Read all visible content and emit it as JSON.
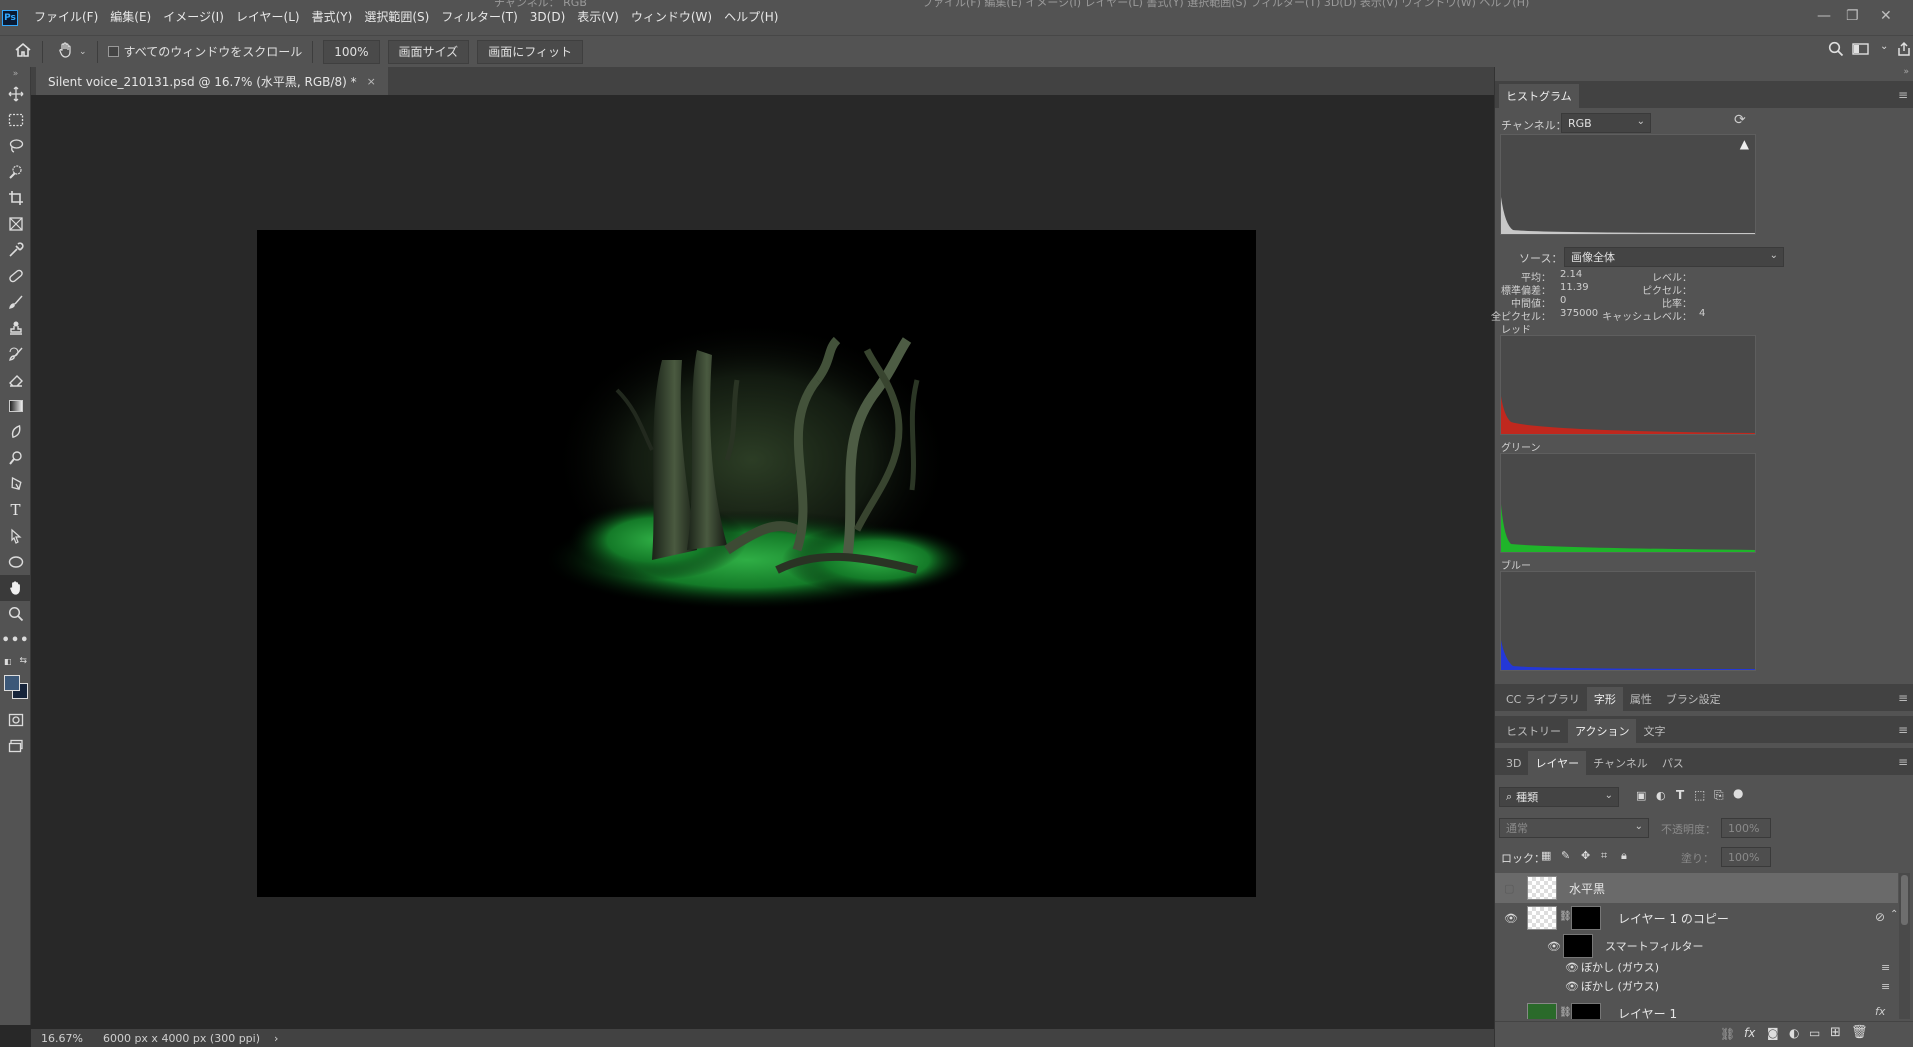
{
  "app": {
    "logo": "Ps",
    "menu": [
      "ファイル(F)",
      "編集(E)",
      "イメージ(I)",
      "レイヤー(L)",
      "書式(Y)",
      "選択範囲(S)",
      "フィルター(T)",
      "3D(D)",
      "表示(V)",
      "ウィンドウ(W)",
      "ヘルプ(H)"
    ],
    "ghost_left": "チャンネル： RGB",
    "ghost_right": "ファイル(F)   編集(E)   イメージ(I)   レイヤー(L)   書式(Y)   選択範囲(S)   フィルター(T)   3D(D)   表示(V)   ウィンドウ(W)   ヘルプ(H)",
    "window_controls": {
      "minimize": "—",
      "restore": "❐",
      "close": "✕"
    }
  },
  "options": {
    "scroll_all_label": "すべてのウィンドウをスクロール",
    "zoom_value": "100%",
    "fill_screen": "画面サイズ",
    "fit_screen": "画面にフィット"
  },
  "document": {
    "tab_title": "Silent voice_210131.psd @ 16.7% (水平黒, RGB/8) *",
    "close_glyph": "×"
  },
  "status": {
    "zoom": "16.67%",
    "doc_size": "6000 px x 4000 px (300 ppi)",
    "arrow": "›"
  },
  "histogram": {
    "tab": "ヒストグラム",
    "channel_label": "チャンネル：",
    "channel_value": "RGB",
    "source_label": "ソース：",
    "source_value": "画像全体",
    "stats_left": [
      {
        "label": "平均：",
        "value": "2.14"
      },
      {
        "label": "標準偏差：",
        "value": "11.39"
      },
      {
        "label": "中間値：",
        "value": "0"
      },
      {
        "label": "全ピクセル：",
        "value": "375000"
      }
    ],
    "stats_right": [
      {
        "label": "レベル：",
        "value": ""
      },
      {
        "label": "ピクセル：",
        "value": ""
      },
      {
        "label": "比率：",
        "value": ""
      },
      {
        "label": "キャッシュレベル：",
        "value": "4"
      }
    ],
    "red_label": "レッド",
    "green_label": "グリーン",
    "blue_label": "ブルー",
    "colors": {
      "rgb": "#c8c8c8",
      "red": "#c0281e",
      "green": "#1fb42a",
      "blue": "#2438d6"
    }
  },
  "panels": {
    "group1": [
      "CC ライブラリ",
      "字形",
      "属性",
      "ブラシ設定"
    ],
    "group2": [
      "ヒストリー",
      "アクション",
      "文字"
    ],
    "group3": [
      "3D",
      "レイヤー",
      "チャンネル",
      "パス"
    ]
  },
  "layers": {
    "filter_kind": "種類",
    "blend_mode": "通常",
    "opacity_label": "不透明度：",
    "opacity_value": "100%",
    "lock_label": "ロック：",
    "fill_label": "塗り：",
    "fill_value": "100%",
    "items": [
      {
        "name": "水平黒"
      },
      {
        "name": "レイヤー 1 のコピー"
      },
      {
        "name": "スマートフィルター"
      },
      {
        "name": "ぼかし (ガウス)"
      },
      {
        "name": "ぼかし (ガウス)"
      },
      {
        "name": "レイヤー 1"
      }
    ]
  }
}
